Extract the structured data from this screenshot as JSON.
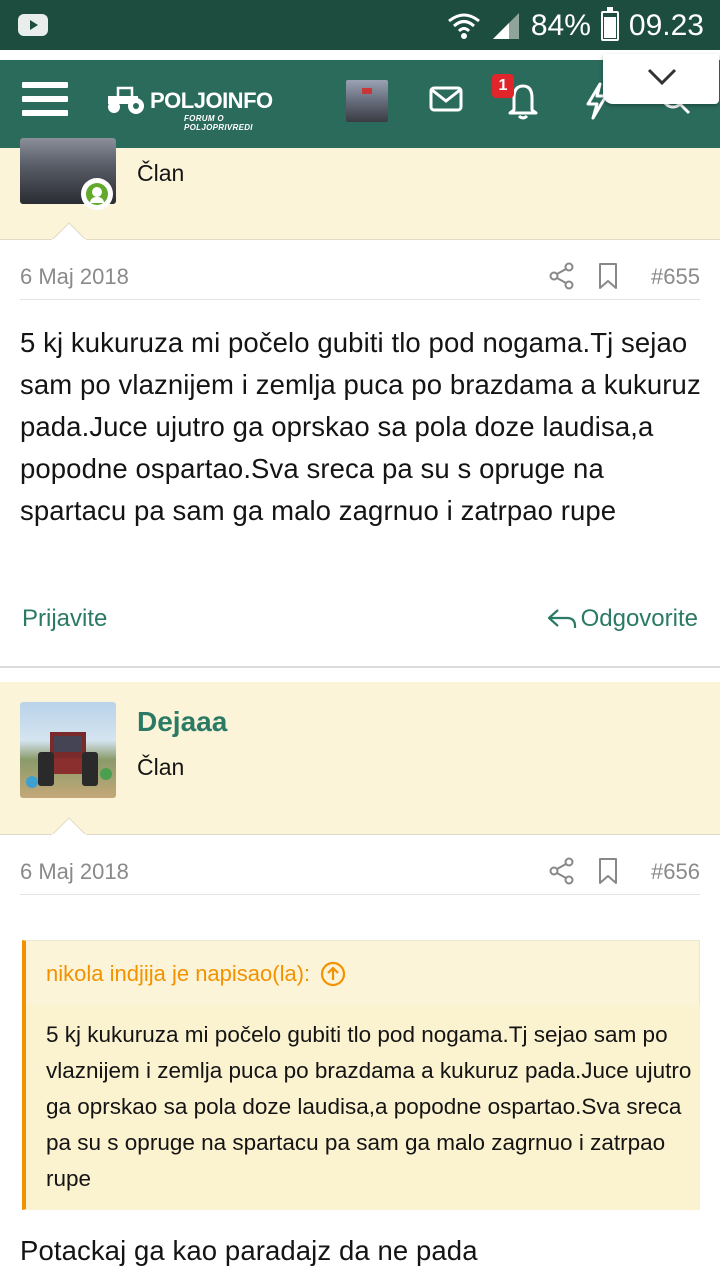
{
  "status_bar": {
    "battery": "84%",
    "time": "09.23",
    "icons": [
      "youtube-icon",
      "wifi-icon",
      "signal-icon",
      "battery-icon"
    ]
  },
  "header": {
    "logo_name": "POLJOINFO",
    "logo_subtitle": "FORUM O POLJOPRIVREDI",
    "notification_count": "1",
    "colors": {
      "bar": "#2b6b5c",
      "status": "#1d4d3f",
      "accent": "#2b7a65",
      "quote": "#f39200"
    }
  },
  "posts": [
    {
      "role": "Član",
      "date": "6 Maj 2018",
      "number": "#655",
      "text": "5 kj kukuruza mi počelo gubiti tlo pod nogama.Tj sejao sam po vlaznijem i zemlja puca po brazdama a kukuruz pada.Juce ujutro ga oprskao sa pola doze laudisa,a popodne ospartao.Sva sreca pa su s opruge na spartacu pa sam ga malo zagrnuo i zatrpao rupe",
      "report_label": "Prijavite",
      "reply_label": "Odgovorite"
    },
    {
      "username": "Dejaaa",
      "role": "Član",
      "date": "6 Maj 2018",
      "number": "#656",
      "quote_header": "nikola indjija je napisao(la):",
      "quote_text": "5 kj kukuruza mi počelo gubiti tlo pod nogama.Tj sejao sam po vlaznijem i zemlja puca po brazdama a kukuruz pada.Juce ujutro ga oprskao sa pola doze laudisa,a popodne ospartao.Sva sreca pa su s opruge na spartacu pa sam ga malo zagrnuo i zatrpao rupe",
      "text": "Potackaj ga kao paradajz da ne pada"
    }
  ]
}
